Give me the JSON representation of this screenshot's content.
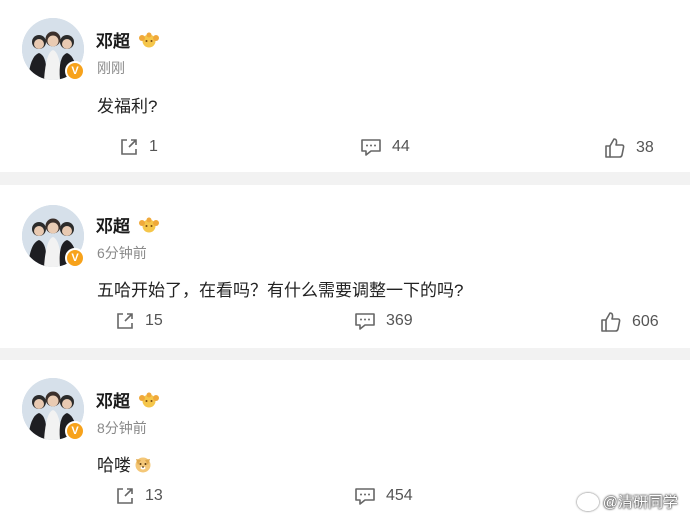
{
  "posts": [
    {
      "user": "邓超",
      "time": "刚刚",
      "text": "发福利?",
      "emoji": "",
      "reposts": "1",
      "comments": "44",
      "likes": "38"
    },
    {
      "user": "邓超",
      "time": "6分钟前",
      "text": "五哈开始了，在看吗？有什么需要调整一下的吗?",
      "emoji": "",
      "reposts": "15",
      "comments": "369",
      "likes": "606"
    },
    {
      "user": "邓超",
      "time": "8分钟前",
      "text": "哈喽",
      "emoji": "dog-emoji",
      "reposts": "13",
      "comments": "454",
      "likes": ""
    }
  ],
  "icons": {
    "verified_badge": "V",
    "crown": "crown-icon",
    "repost": "repost-icon",
    "comment": "comment-icon",
    "like": "thumbs-up-icon"
  },
  "watermark": {
    "text": "@清研同学"
  },
  "colors": {
    "separator": "#f2f2f2",
    "badge": "#f7a21b",
    "meta": "#8a8a8a"
  }
}
